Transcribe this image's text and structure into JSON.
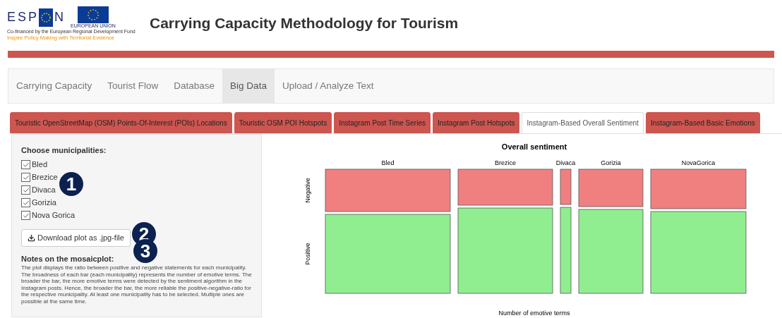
{
  "header": {
    "logo": {
      "left_text": "ESP",
      "right_text": "N",
      "eu_label": "EUROPEAN UNION",
      "cofinanced": "Co-financed by the European Regional Development Fund",
      "slogan": "Inspire Policy Making with Territorial Evidence"
    },
    "title": "Carrying Capacity Methodology for Tourism"
  },
  "navbar": [
    {
      "label": "Carrying Capacity",
      "selected": false
    },
    {
      "label": "Tourist Flow",
      "selected": false
    },
    {
      "label": "Database",
      "selected": false
    },
    {
      "label": "Big Data",
      "selected": true
    },
    {
      "label": "Upload / Analyze Text",
      "selected": false
    }
  ],
  "tabs": [
    {
      "label": "Touristic OpenStreetMap (OSM) Points-Of-Interest (POIs) Locations",
      "selected": false
    },
    {
      "label": "Touristic OSM POI Hotspots",
      "selected": false
    },
    {
      "label": "Instagram Post Time Series",
      "selected": false
    },
    {
      "label": "Instagram Post Hotspots",
      "selected": false
    },
    {
      "label": "Instagram-Based Overall Sentiment",
      "selected": true
    },
    {
      "label": "Instagram-Based Basic Emotions",
      "selected": false
    }
  ],
  "sidebar": {
    "heading": "Choose municipalities:",
    "municipalities": [
      {
        "label": "Bled",
        "checked": true
      },
      {
        "label": "Brezice",
        "checked": true
      },
      {
        "label": "Divaca",
        "checked": true
      },
      {
        "label": "Gorizia",
        "checked": true
      },
      {
        "label": "Nova Gorica",
        "checked": true
      }
    ],
    "download_button": "Download plot as .jpg-file",
    "notes_heading": "Notes on the mosaicplot:",
    "notes": "The plot displays the ratio between positive and negative statements for each municipality. The broadness of each bar (each municipality) represents the number of emotive terms. The broader the bar, the more emotive terms were detected by the sentiment algorithm in the Instagram posts. Hence, the broader the bar, the more reliable the positive-negative-ratio for the respective municipality. At least one municipality has to be selected. Multiple ones are possible at the same time."
  },
  "callouts": [
    "1",
    "2",
    "3"
  ],
  "plot": {
    "title": "Overall sentiment",
    "categories": [
      "Bled",
      "Brezice",
      "Divaca",
      "Gorizia",
      "NovaGorica"
    ],
    "rows": [
      {
        "label": "Negative",
        "color": "#f08080"
      },
      {
        "label": "Positive",
        "color": "#90ee90"
      }
    ],
    "xlabel": "Number of emotive terms"
  }
}
